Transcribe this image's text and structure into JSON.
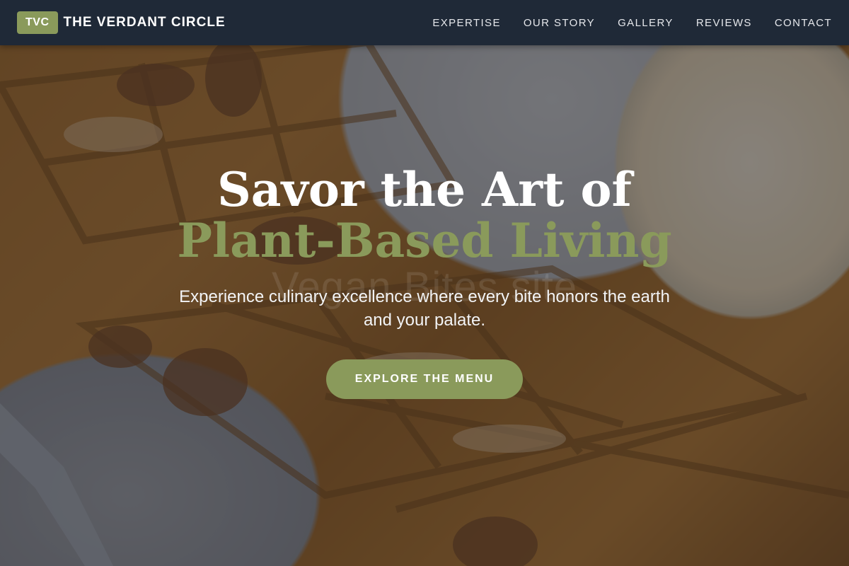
{
  "brand": {
    "badge": "TVC",
    "name": "THE VERDANT CIRCLE"
  },
  "nav": {
    "items": [
      {
        "label": "EXPERTISE"
      },
      {
        "label": "OUR STORY"
      },
      {
        "label": "GALLERY"
      },
      {
        "label": "REVIEWS"
      },
      {
        "label": "CONTACT"
      }
    ]
  },
  "hero": {
    "headline_line1": "Savor the Art of",
    "headline_line2": "Plant-Based Living",
    "watermark": "Vegan Bites site",
    "subtitle": "Experience culinary excellence where every bite honors the earth and your palate.",
    "cta_label": "EXPLORE THE MENU"
  },
  "colors": {
    "accent": "#8a9a5b",
    "nav_background": "#1f2937",
    "text_light": "#ffffff"
  }
}
